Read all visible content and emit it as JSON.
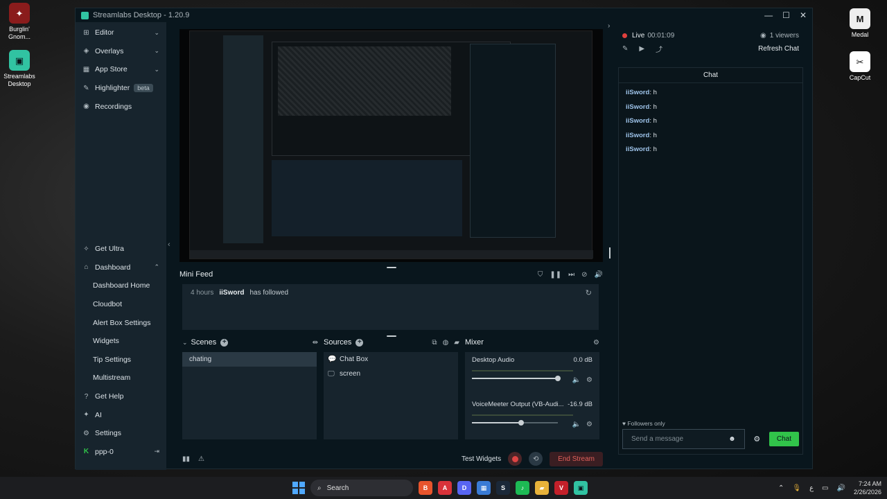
{
  "desktop": {
    "icons": [
      {
        "label": "Burglin' Gnom..."
      },
      {
        "label": "Streamlabs Desktop"
      },
      {
        "label": "Medal"
      },
      {
        "label": "CapCut"
      }
    ]
  },
  "window": {
    "title": "Streamlabs Desktop - 1.20.9",
    "controls": {
      "minimize": "—",
      "maximize": "☐",
      "close": "✕"
    }
  },
  "sidebar": {
    "items": [
      {
        "label": "Editor",
        "icon": "editor-icon"
      },
      {
        "label": "Overlays",
        "icon": "overlays-icon"
      },
      {
        "label": "App Store",
        "icon": "app-store-icon"
      },
      {
        "label": "Highlighter",
        "icon": "highlighter-icon",
        "badge": "beta"
      },
      {
        "label": "Recordings",
        "icon": "recordings-icon"
      }
    ],
    "bottom_items": [
      {
        "label": "Get Ultra"
      },
      {
        "label": "Dashboard"
      },
      {
        "label": "Dashboard Home"
      },
      {
        "label": "Cloudbot"
      },
      {
        "label": "Alert Box Settings"
      },
      {
        "label": "Widgets"
      },
      {
        "label": "Tip Settings"
      },
      {
        "label": "Multistream"
      },
      {
        "label": "Get Help"
      },
      {
        "label": "AI"
      },
      {
        "label": "Settings"
      },
      {
        "label": "ppp-0"
      }
    ]
  },
  "mini_feed": {
    "title": "Mini Feed",
    "entries": [
      {
        "time": "4 hours",
        "user": "iiSword",
        "action": "has followed"
      }
    ]
  },
  "scenes": {
    "title": "Scenes",
    "items": [
      {
        "label": "chating",
        "selected": true
      }
    ]
  },
  "sources": {
    "title": "Sources",
    "items": [
      {
        "label": "Chat Box",
        "icon": "chat-icon"
      },
      {
        "label": "screen",
        "icon": "monitor-icon"
      }
    ]
  },
  "mixer": {
    "title": "Mixer",
    "channels": [
      {
        "name": "Desktop Audio",
        "db": "0.0 dB",
        "volume": 1.0
      },
      {
        "name": "VoiceMeeter Output (VB-Audi...",
        "db": "-16.9 dB",
        "volume": 0.57
      }
    ]
  },
  "bottombar": {
    "test_widgets": "Test Widgets",
    "end_stream": "End Stream"
  },
  "chat_pane": {
    "live_label": "Live",
    "live_time": "00:01:09",
    "viewers": "1 viewers",
    "refresh_chat": "Refresh Chat",
    "chat_title": "Chat",
    "messages": [
      {
        "user": "iiSword",
        "text": "h"
      },
      {
        "user": "iiSword",
        "text": "h"
      },
      {
        "user": "iiSword",
        "text": "h"
      },
      {
        "user": "iiSword",
        "text": "h"
      },
      {
        "user": "iiSword",
        "text": "h"
      }
    ],
    "followers_only": "Followers only",
    "input_placeholder": "Send a message",
    "send_label": "Chat"
  },
  "taskbar": {
    "search": "Search",
    "time": "7:24 AM",
    "date": "2/26/2026"
  },
  "colors": {
    "accent": "#31c3a2",
    "live": "#e0403d",
    "send": "#31c34a"
  }
}
